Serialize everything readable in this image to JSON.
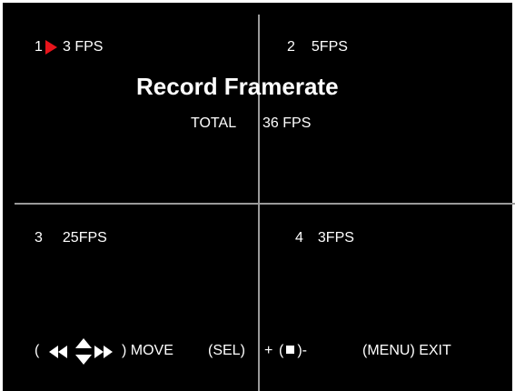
{
  "screen": {
    "title": "Record Framerate",
    "total_label": "TOTAL",
    "total_value": "36 FPS",
    "selection_color": "#e8141b",
    "channels": [
      {
        "number": "1",
        "value": "3 FPS",
        "selected": true
      },
      {
        "number": "2",
        "value": "5FPS",
        "selected": false
      },
      {
        "number": "3",
        "value": "25FPS",
        "selected": false
      },
      {
        "number": "4",
        "value": "3FPS",
        "selected": false
      }
    ]
  },
  "footer": {
    "paren_open": "(",
    "move_icons": [
      "left-double-arrow-icon",
      "up-down-arrow-icon",
      "right-double-arrow-icon"
    ],
    "move_label": ") MOVE",
    "sel_label": "(SEL)",
    "plus_label": "+",
    "stop_open": "(",
    "stop_close": ")-",
    "stop_icon": "stop-square-icon",
    "exit_label": "(MENU) EXIT"
  }
}
